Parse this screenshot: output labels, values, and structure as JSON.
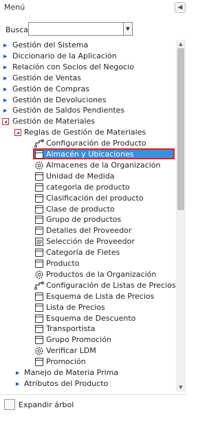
{
  "panel": {
    "title": "Menú",
    "collapse_icon": "chevron-left-icon",
    "search": {
      "label": "Buscar:",
      "value": "",
      "placeholder": ""
    },
    "footer": {
      "expand_tree_label": "Expandir árbol",
      "expand_tree_checked": false
    }
  },
  "tree": {
    "top_items": [
      "Gestión del Sistema",
      "Diccionario de la Aplicación",
      "Relación con Socios del Negocio",
      "Gestión de Ventas",
      "Gestión de Compras",
      "Gestión de Devoluciones",
      "Gestión de Saldos Pendientes"
    ],
    "materials": {
      "label": "Gestión de Materiales",
      "rules": {
        "label": "Reglas de Gestión de Materiales",
        "children": [
          {
            "label": "Configuración de Producto",
            "icon": "process-icon"
          },
          {
            "label": "Almacén y Ubicaciones",
            "icon": "window-icon",
            "selected": true
          },
          {
            "label": "Almacenes de la Organización",
            "icon": "gear-icon"
          },
          {
            "label": "Unidad de Medida",
            "icon": "window-icon"
          },
          {
            "label": "categoria de producto",
            "icon": "window-icon"
          },
          {
            "label": "Clasificación del producto",
            "icon": "window-icon"
          },
          {
            "label": "Clase de producto",
            "icon": "window-icon"
          },
          {
            "label": "Grupo de productos",
            "icon": "window-icon"
          },
          {
            "label": "Detalles del Proveedor",
            "icon": "window-icon"
          },
          {
            "label": "Selección de Proveedor",
            "icon": "report-icon"
          },
          {
            "label": "Categoría de Fletes",
            "icon": "window-icon"
          },
          {
            "label": "Producto",
            "icon": "window-icon"
          },
          {
            "label": "Productos de la Organización",
            "icon": "gear-icon"
          },
          {
            "label": "Configuración de Listas de Precios",
            "icon": "process-icon"
          },
          {
            "label": "Esquema de Lista de Precios",
            "icon": "window-icon"
          },
          {
            "label": "Lista de Precios",
            "icon": "window-icon"
          },
          {
            "label": "Esquema de Descuento",
            "icon": "window-icon"
          },
          {
            "label": "Transportista",
            "icon": "window-icon"
          },
          {
            "label": "Grupo Promoción",
            "icon": "window-icon"
          },
          {
            "label": "Verificar LDM",
            "icon": "gear-icon"
          },
          {
            "label": "Promoción",
            "icon": "window-icon"
          }
        ]
      },
      "siblings": [
        "Manejo de Materia Prima",
        "Atributos del Producto"
      ]
    }
  },
  "colors": {
    "selection": "#3a8fdd",
    "highlight_border": "#dd2222",
    "expander_arrow": "#1f5aa6"
  }
}
